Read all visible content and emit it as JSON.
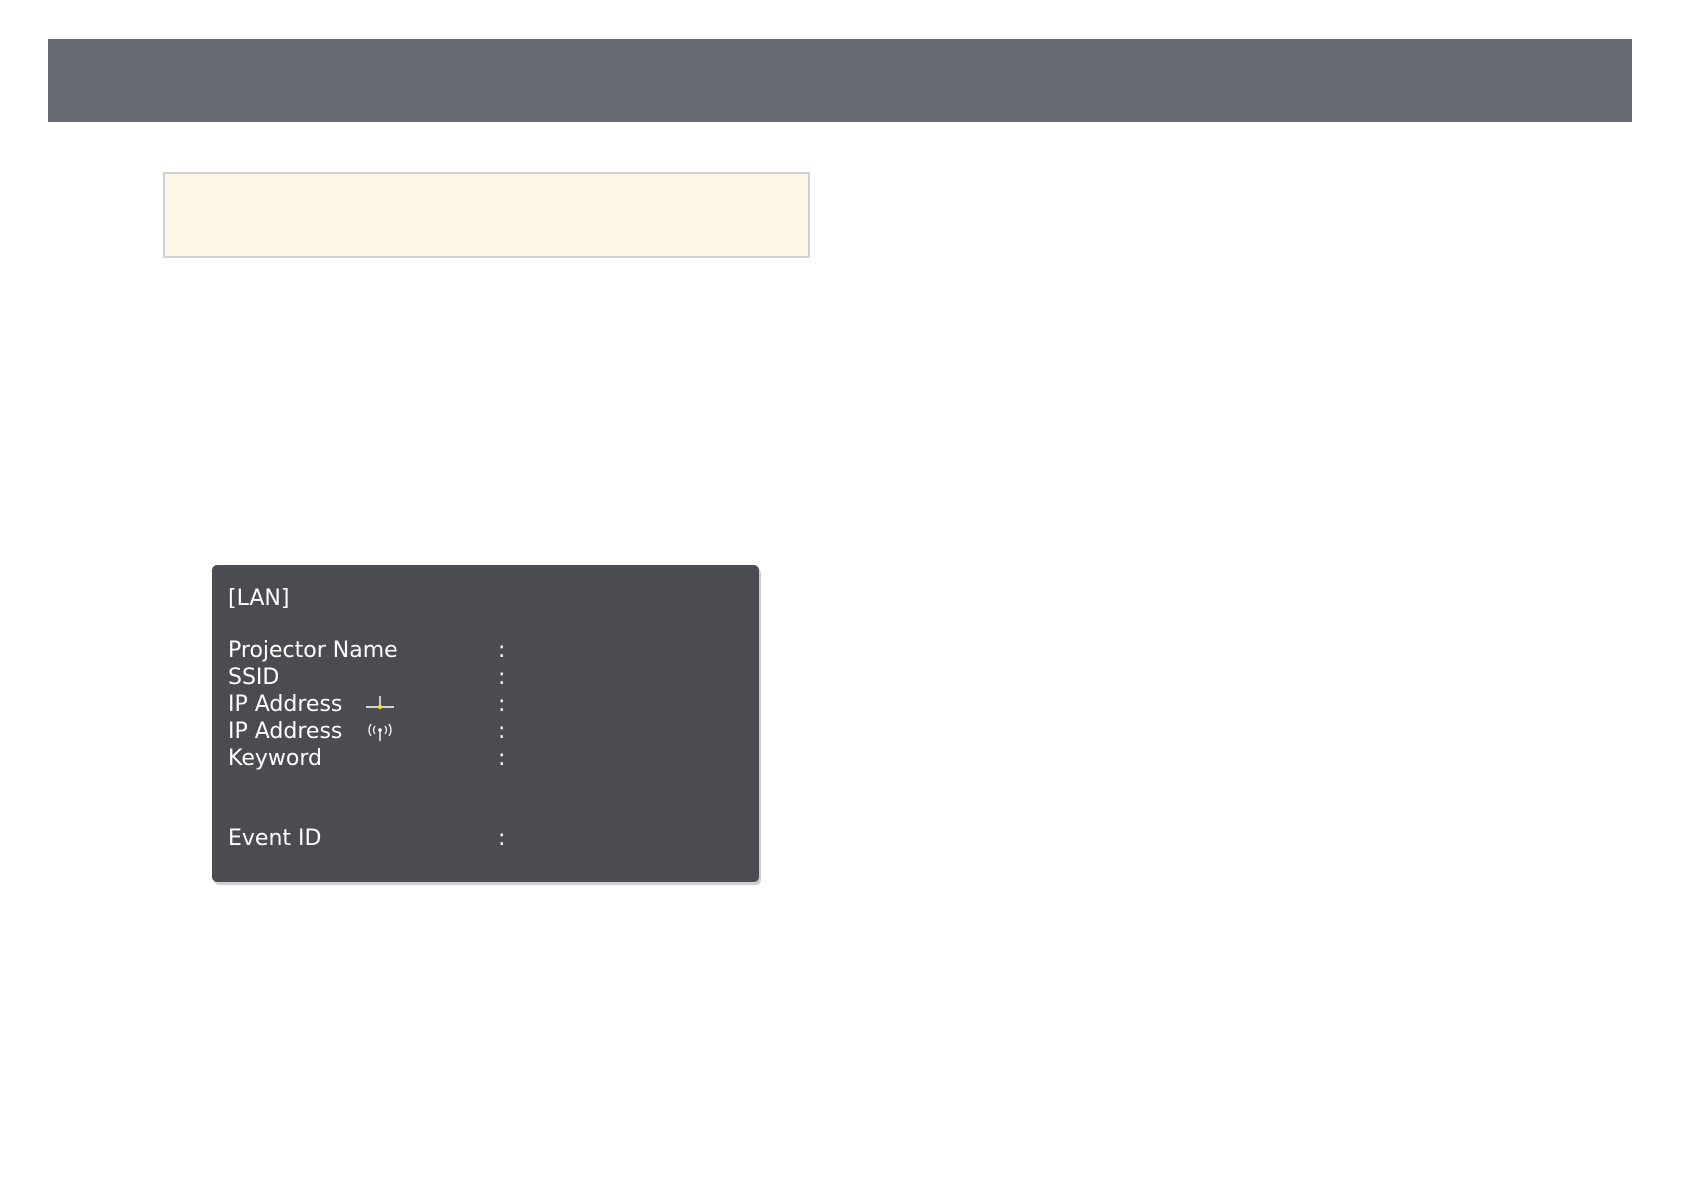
{
  "lan_screen": {
    "title": "[LAN]",
    "separator": ":",
    "rows": [
      {
        "label": "Projector Name",
        "icon": null
      },
      {
        "label": "SSID",
        "icon": null
      },
      {
        "label": "IP Address",
        "icon": "wired-lan-icon"
      },
      {
        "label": "IP Address",
        "icon": "wireless-lan-icon"
      },
      {
        "label": "Keyword",
        "icon": null
      },
      {
        "label": "Event ID",
        "icon": null
      }
    ]
  },
  "colors": {
    "header_bar": "#676a72",
    "note_background": "#fdf8e6",
    "screen_background": "#4b4c51",
    "wired_icon_accent": "#f2e000"
  }
}
